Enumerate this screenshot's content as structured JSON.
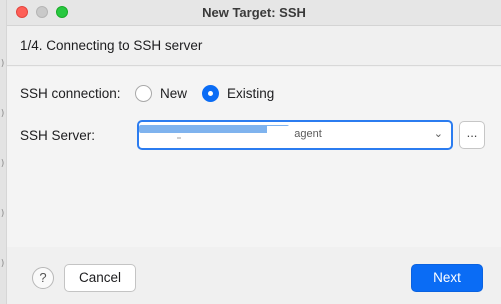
{
  "window": {
    "title": "New Target: SSH"
  },
  "step": {
    "title": "1/4. Connecting to SSH server"
  },
  "ssh_connection": {
    "label": "SSH connection:",
    "options": [
      {
        "label": "New",
        "selected": false
      },
      {
        "label": "Existing",
        "selected": true
      }
    ]
  },
  "ssh_server": {
    "label": "SSH Server:",
    "value_visible": "03 agent",
    "browse_label": "..."
  },
  "footer": {
    "help_label": "?",
    "cancel_label": "Cancel",
    "next_label": "Next"
  },
  "colors": {
    "accent": "#0a6cf5",
    "close": "#fe5f57",
    "maximize": "#28c840"
  }
}
